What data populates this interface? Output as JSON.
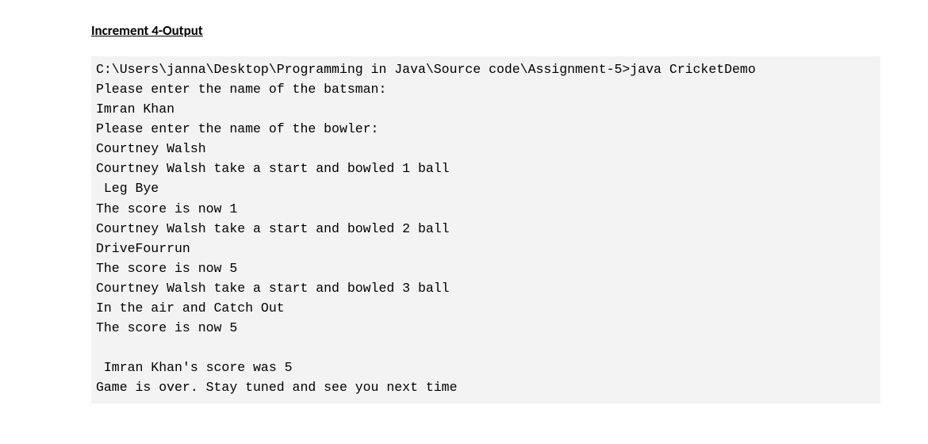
{
  "heading": "Increment 4-Output",
  "code_lines": {
    "l0": "C:\\Users\\janna\\Desktop\\Programming in Java\\Source code\\Assignment-5>java CricketDemo",
    "l1": "Please enter the name of the batsman:",
    "l2": "Imran Khan",
    "l3": "Please enter the name of the bowler:",
    "l4": "Courtney Walsh",
    "l5": "Courtney Walsh take a start and bowled 1 ball",
    "l6": " Leg Bye",
    "l7": "The score is now 1",
    "l8": "Courtney Walsh take a start and bowled 2 ball",
    "l9": "DriveFourrun",
    "l10": "The score is now 5",
    "l11": "Courtney Walsh take a start and bowled 3 ball",
    "l12": "In the air and Catch Out",
    "l13": "The score is now 5",
    "l14": "",
    "l15": " Imran Khan's score was 5",
    "l16": "Game is over. Stay tuned and see you next time"
  }
}
